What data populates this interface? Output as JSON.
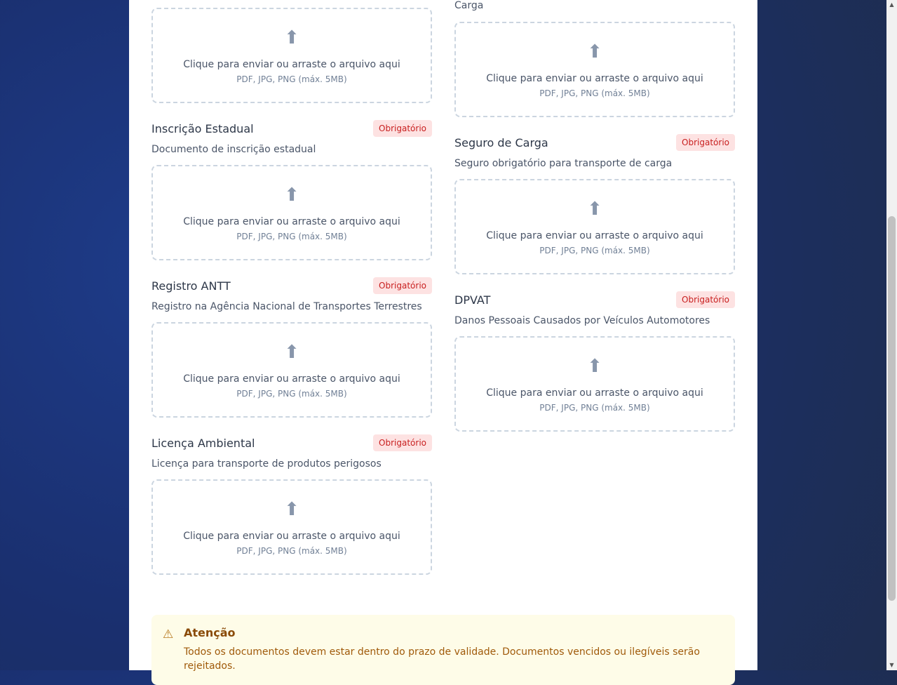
{
  "upload": {
    "icon": "upload-arrow-icon",
    "arrow_glyph": "⬆",
    "prompt": "Clique para enviar ou arraste o arquivo aqui",
    "hint": "PDF, JPG, PNG (máx. 5MB)"
  },
  "badge_label": "Obrigatório",
  "left_column": [
    {
      "title": "",
      "description": ""
    },
    {
      "title": "Inscrição Estadual",
      "description": "Documento de inscrição estadual"
    },
    {
      "title": "Registro ANTT",
      "description": "Registro na Agência Nacional de Transportes Terrestres"
    },
    {
      "title": "Licença Ambiental",
      "description": "Licença para transporte de produtos perigosos"
    }
  ],
  "right_column": [
    {
      "title": "",
      "description": "Carga"
    },
    {
      "title": "Seguro de Carga",
      "description": "Seguro obrigatório para transporte de carga"
    },
    {
      "title": "DPVAT",
      "description": "Danos Pessoais Causados por Veículos Automotores"
    }
  ],
  "alert": {
    "icon": "warning-icon",
    "glyph": "⚠",
    "title": "Atenção",
    "text": "Todos os documentos devem estar dentro do prazo de validade. Documentos vencidos ou ilegíveis serão rejeitados."
  },
  "colors": {
    "background": "#1a2f6e",
    "badge_bg": "#fde2e2",
    "badge_text": "#c81e1e",
    "alert_bg": "#fefce8",
    "alert_text": "#a05a0a"
  }
}
